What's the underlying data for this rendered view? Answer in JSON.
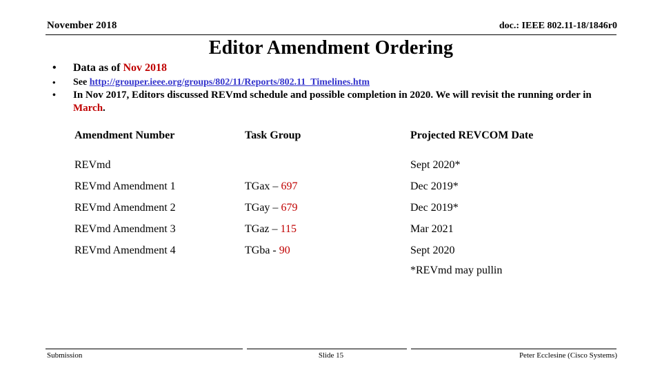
{
  "header": {
    "date": "November 2018",
    "doc_id": "doc.: IEEE 802.11-18/1846r0"
  },
  "title": "Editor Amendment Ordering",
  "bullets": [
    {
      "level": 1,
      "marker": "•",
      "prefix": "Data as of ",
      "highlight": "Nov 2018",
      "suffix": ""
    },
    {
      "level": 2,
      "marker": "•",
      "prefix": "See ",
      "link": "http://grouper.ieee.org/groups/802/11/Reports/802.11_Timelines.htm",
      "suffix": ""
    },
    {
      "level": 3,
      "marker": "•",
      "prefix": "In Nov 2017, Editors discussed REVmd schedule and possible completion in 2020. We will revisit the running order in ",
      "highlight": "March",
      "suffix": "."
    }
  ],
  "table": {
    "columns": [
      "Amendment Number",
      "Task Group",
      "Projected REVCOM Date"
    ],
    "rows": [
      {
        "amendment": "REVmd",
        "task_group_prefix": "",
        "task_group_number": "",
        "revcom_date": "Sept 2020*"
      },
      {
        "amendment": "REVmd Amendment 1",
        "task_group_prefix": "TGax – ",
        "task_group_number": "697",
        "revcom_date": "Dec 2019*"
      },
      {
        "amendment": "REVmd Amendment 2",
        "task_group_prefix": "TGay – ",
        "task_group_number": "679",
        "revcom_date": "Dec 2019*"
      },
      {
        "amendment": "REVmd Amendment 3",
        "task_group_prefix": "TGaz – ",
        "task_group_number": "115",
        "revcom_date": "Mar 2021"
      },
      {
        "amendment": "REVmd Amendment 4",
        "task_group_prefix": "TGba - ",
        "task_group_number": "90",
        "revcom_date": "Sept 2020"
      }
    ],
    "footnote": "*REVmd may pullin"
  },
  "footer": {
    "left": "Submission",
    "center": "Slide 15",
    "right": "Peter Ecclesine (Cisco Systems)"
  },
  "colors": {
    "highlight_red": "#C00000",
    "hyperlink_blue": "#3333CC",
    "text_black": "#000000",
    "background": "#FFFFFF"
  }
}
